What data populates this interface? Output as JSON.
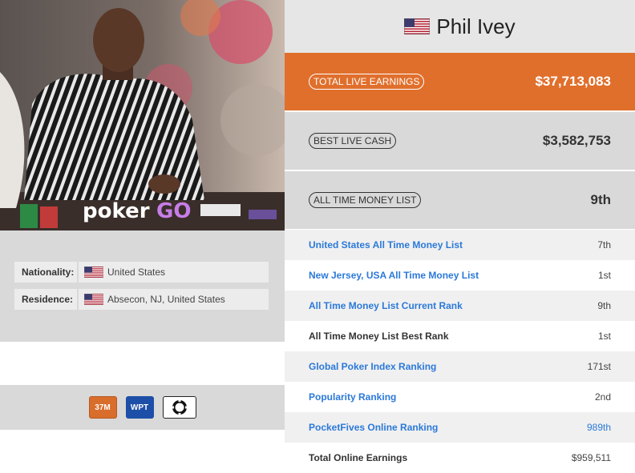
{
  "player": {
    "name": "Phil Ivey",
    "flag_icon": "us-flag-icon"
  },
  "photo": {
    "logo_text_1": "poker",
    "logo_text_2": "GO"
  },
  "info": {
    "nationality_label": "Nationality:",
    "nationality_value": "United States",
    "residence_label": "Residence:",
    "residence_value": "Absecon, NJ, United States"
  },
  "badges": {
    "money_badge": "37M",
    "wpt_badge": "WPT",
    "wsop_badge_icon": "wsop-icon"
  },
  "stats": {
    "total_live_label": "TOTAL LIVE EARNINGS",
    "total_live_value": "$37,713,083",
    "best_cash_label": "BEST LIVE CASH",
    "best_cash_value": "$3,582,753",
    "all_time_label": "ALL TIME MONEY LIST",
    "all_time_value": "9th"
  },
  "rankings": [
    {
      "label": "United States All Time Money List",
      "value": "7th"
    },
    {
      "label": "New Jersey, USA All Time Money List",
      "value": "1st"
    },
    {
      "label": "All Time Money List Current Rank",
      "value": "9th"
    },
    {
      "label": "All Time Money List Best Rank",
      "value": "1st"
    },
    {
      "label": "Global Poker Index Ranking",
      "value": "171st"
    },
    {
      "label": "Popularity Ranking",
      "value": "2nd"
    },
    {
      "label": "PocketFives Online Ranking",
      "value": "989th"
    },
    {
      "label": "Total Online Earnings",
      "value": "$959,511"
    }
  ],
  "colors": {
    "accent_orange": "#e06f2c",
    "link_blue": "#2b79d9"
  }
}
